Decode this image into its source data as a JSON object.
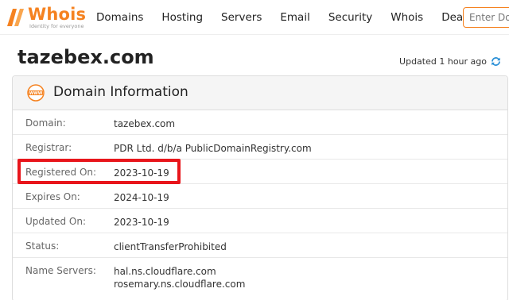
{
  "header": {
    "logo_text": "Whois",
    "logo_tagline": "Identity for everyone",
    "nav": [
      "Domains",
      "Hosting",
      "Servers",
      "Email",
      "Security",
      "Whois",
      "Deals"
    ],
    "search_placeholder": "Enter Domain or IP"
  },
  "page": {
    "domain": "tazebex.com",
    "updated": "Updated 1 hour ago"
  },
  "card": {
    "title": "Domain Information",
    "icon": "www-icon",
    "rows": [
      {
        "label": "Domain:",
        "value": "tazebex.com"
      },
      {
        "label": "Registrar:",
        "value": "PDR Ltd. d/b/a PublicDomainRegistry.com"
      },
      {
        "label": "Registered On:",
        "value": "2023-10-19"
      },
      {
        "label": "Expires On:",
        "value": "2024-10-19"
      },
      {
        "label": "Updated On:",
        "value": "2023-10-19"
      },
      {
        "label": "Status:",
        "value": "clientTransferProhibited"
      },
      {
        "label": "Name Servers:",
        "value": "hal.ns.cloudflare.com",
        "value2": "rosemary.ns.cloudflare.com"
      }
    ]
  },
  "colors": {
    "accent": "#f58220",
    "highlight": "#e8151b",
    "refresh": "#2a8fd6"
  }
}
